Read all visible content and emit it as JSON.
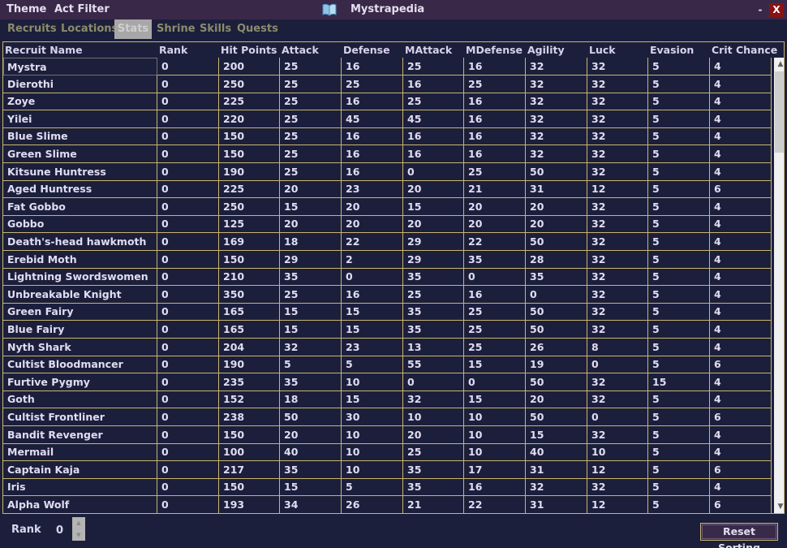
{
  "menu": {
    "theme": "Theme",
    "act_filter": "Act Filter"
  },
  "window": {
    "title": "Mystrapedia",
    "minimize": "-",
    "close": "X",
    "icon": "book-icon"
  },
  "tabs": [
    {
      "label": "Recruits"
    },
    {
      "label": "Locations"
    },
    {
      "label": "Stats",
      "active": true
    },
    {
      "label": "Shrine"
    },
    {
      "label": "Skills"
    },
    {
      "label": "Quests"
    }
  ],
  "table": {
    "columns": [
      "Recruit Name",
      "Rank",
      "Hit Points",
      "Attack",
      "Defense",
      "MAttack",
      "MDefense",
      "Agility",
      "Luck",
      "Evasion",
      "Crit Chance"
    ],
    "rows": [
      [
        "Mystra",
        "0",
        "200",
        "25",
        "16",
        "25",
        "16",
        "32",
        "32",
        "5",
        "4"
      ],
      [
        "Dierothi",
        "0",
        "250",
        "25",
        "25",
        "16",
        "25",
        "32",
        "32",
        "5",
        "4"
      ],
      [
        "Zoye",
        "0",
        "225",
        "25",
        "16",
        "25",
        "16",
        "32",
        "32",
        "5",
        "4"
      ],
      [
        "Yilei",
        "0",
        "220",
        "25",
        "45",
        "45",
        "16",
        "32",
        "32",
        "5",
        "4"
      ],
      [
        "Blue Slime",
        "0",
        "150",
        "25",
        "16",
        "16",
        "16",
        "32",
        "32",
        "5",
        "4"
      ],
      [
        "Green Slime",
        "0",
        "150",
        "25",
        "16",
        "16",
        "16",
        "32",
        "32",
        "5",
        "4"
      ],
      [
        "Kitsune Huntress",
        "0",
        "190",
        "25",
        "16",
        "0",
        "25",
        "50",
        "32",
        "5",
        "4"
      ],
      [
        "Aged Huntress",
        "0",
        "225",
        "20",
        "23",
        "20",
        "21",
        "31",
        "12",
        "5",
        "6"
      ],
      [
        "Fat Gobbo",
        "0",
        "250",
        "15",
        "20",
        "15",
        "20",
        "20",
        "32",
        "5",
        "4"
      ],
      [
        "Gobbo",
        "0",
        "125",
        "20",
        "20",
        "20",
        "20",
        "20",
        "32",
        "5",
        "4"
      ],
      [
        "Death's-head hawkmoth",
        "0",
        "169",
        "18",
        "22",
        "29",
        "22",
        "50",
        "32",
        "5",
        "4"
      ],
      [
        "Erebid Moth",
        "0",
        "150",
        "29",
        "2",
        "29",
        "35",
        "28",
        "32",
        "5",
        "4"
      ],
      [
        "Lightning Swordswomen",
        "0",
        "210",
        "35",
        "0",
        "35",
        "0",
        "35",
        "32",
        "5",
        "4"
      ],
      [
        "Unbreakable Knight",
        "0",
        "350",
        "25",
        "16",
        "25",
        "16",
        "0",
        "32",
        "5",
        "4"
      ],
      [
        "Green Fairy",
        "0",
        "165",
        "15",
        "15",
        "35",
        "25",
        "50",
        "32",
        "5",
        "4"
      ],
      [
        "Blue Fairy",
        "0",
        "165",
        "15",
        "15",
        "35",
        "25",
        "50",
        "32",
        "5",
        "4"
      ],
      [
        "Nyth Shark",
        "0",
        "204",
        "32",
        "23",
        "13",
        "25",
        "26",
        "8",
        "5",
        "4"
      ],
      [
        "Cultist Bloodmancer",
        "0",
        "190",
        "5",
        "5",
        "55",
        "15",
        "19",
        "0",
        "5",
        "6"
      ],
      [
        "Furtive Pygmy",
        "0",
        "235",
        "35",
        "10",
        "0",
        "0",
        "50",
        "32",
        "15",
        "4"
      ],
      [
        "Goth",
        "0",
        "152",
        "18",
        "15",
        "32",
        "15",
        "20",
        "32",
        "5",
        "4"
      ],
      [
        "Cultist Frontliner",
        "0",
        "238",
        "50",
        "30",
        "10",
        "10",
        "50",
        "0",
        "5",
        "6"
      ],
      [
        "Bandit Revenger",
        "0",
        "150",
        "20",
        "10",
        "20",
        "10",
        "15",
        "32",
        "5",
        "4"
      ],
      [
        "Mermail",
        "0",
        "100",
        "40",
        "10",
        "25",
        "10",
        "40",
        "10",
        "5",
        "4"
      ],
      [
        "Captain Kaja",
        "0",
        "217",
        "35",
        "10",
        "35",
        "17",
        "31",
        "12",
        "5",
        "6"
      ],
      [
        "Iris",
        "0",
        "150",
        "15",
        "5",
        "35",
        "16",
        "32",
        "32",
        "5",
        "4"
      ],
      [
        "Alpha Wolf",
        "0",
        "193",
        "34",
        "26",
        "21",
        "22",
        "31",
        "12",
        "5",
        "6"
      ]
    ]
  },
  "footer": {
    "rank_label": "Rank",
    "rank_value": "0",
    "reset_label": "Reset Sorting"
  },
  "colors": {
    "background": "#1c1f3b",
    "titlebar": "#3a2848",
    "grid_line": "#c9b56f",
    "active_tab": "#a7a7a7",
    "close_button": "#8a1212"
  }
}
